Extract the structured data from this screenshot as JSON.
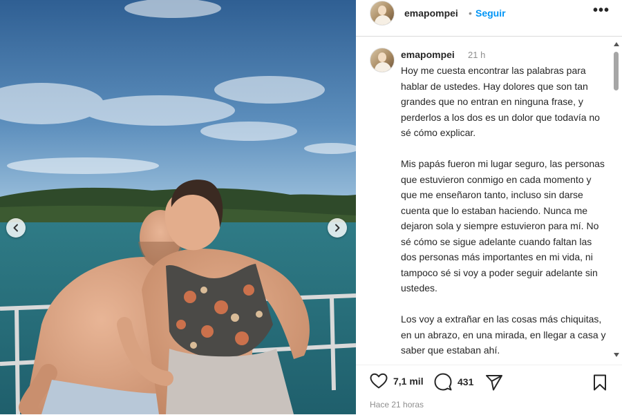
{
  "post": {
    "username": "emapompei",
    "separator": "•",
    "follow_label": "Seguir",
    "more_label": "•••",
    "caption": {
      "username": "emapompei",
      "time": "21 h",
      "paragraphs": [
        "Hoy me cuesta encontrar las palabras para hablar de ustedes. Hay dolores que son tan grandes que no entran en ninguna frase, y perderlos a los dos es un dolor que todavía no sé cómo explicar.",
        "Mis papás fueron mi lugar seguro, las personas que estuvieron conmigo en cada momento y que me enseñaron tanto, incluso sin darse cuenta que lo estaban haciendo. Nunca me dejaron sola y siempre estuvieron para mí. No sé cómo se sigue adelante cuando faltan las dos personas más importantes en mi vida, ni tampoco sé si voy a poder seguir adelante sin ustedes.",
        "Los voy a extrañar en las cosas más chiquitas, en un abrazo, en una mirada, en llegar a casa y saber que estaban ahí."
      ]
    },
    "likes": "7,1 mil",
    "comments": "431",
    "time_ago": "Hace 21 horas"
  },
  "icons": {
    "prev": "chevron-left-icon",
    "next": "chevron-right-icon",
    "like": "heart-icon",
    "comment": "comment-bubble-icon",
    "share": "paper-plane-icon",
    "save": "bookmark-icon"
  },
  "colors": {
    "accent": "#0095f6",
    "text": "#262626",
    "muted": "#8e8e8e"
  }
}
